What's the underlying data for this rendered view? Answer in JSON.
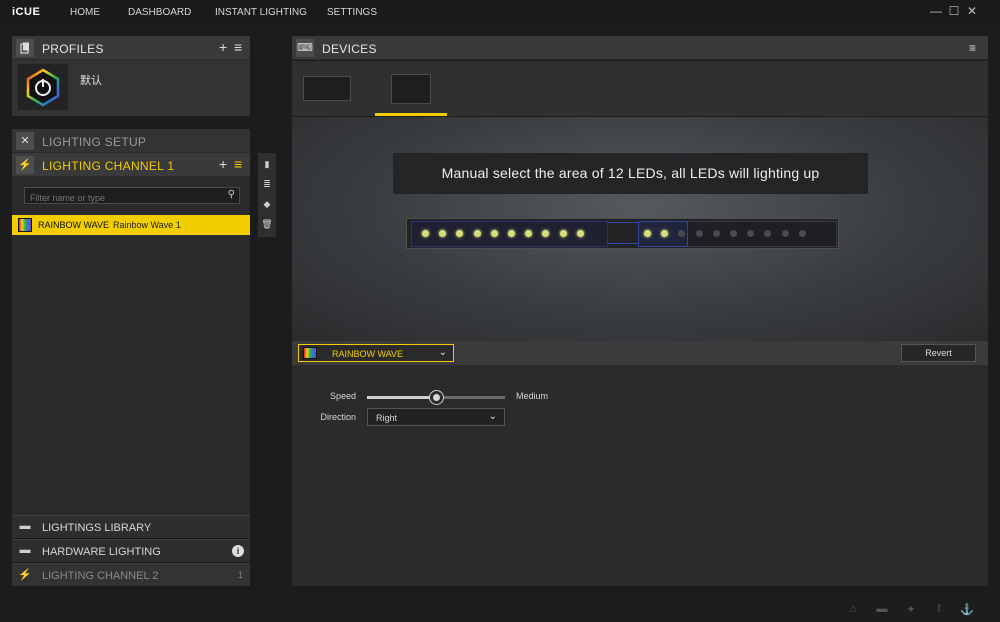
{
  "app": {
    "name": "iCUE"
  },
  "nav": [
    "HOME",
    "DASHBOARD",
    "INSTANT LIGHTING",
    "SETTINGS"
  ],
  "window_controls": {
    "minimize": "—",
    "maximize": "☐",
    "close": "✕"
  },
  "profiles": {
    "title": "PROFILES",
    "add": "+",
    "menu": "≡",
    "items": [
      {
        "name": "默认"
      }
    ]
  },
  "lighting_setup": {
    "title": "LIGHTING SETUP"
  },
  "lighting_channel": {
    "title": "LIGHTING CHANNEL 1",
    "add": "+",
    "menu": "≡",
    "filter_placeholder": "Filter name or type",
    "effects": [
      {
        "type": "RAINBOW WAVE",
        "name": "Rainbow Wave 1"
      }
    ]
  },
  "left_bottom": {
    "library": "LIGHTINGS LIBRARY",
    "hardware": "HARDWARE LIGHTING",
    "channel2": "LIGHTING CHANNEL 2",
    "channel2_count": "1"
  },
  "devices": {
    "title": "DEVICES"
  },
  "stage": {
    "banner": "Manual select the area of 12 LEDs, all LEDs will lighting up",
    "strip_left_leds": [
      1,
      1,
      1,
      1,
      1,
      1,
      1,
      1,
      1,
      1
    ],
    "strip_right_leds": [
      1,
      1,
      0,
      0,
      0,
      0,
      0,
      0,
      0,
      0
    ]
  },
  "effect_bar": {
    "selected_effect": "RAINBOW WAVE",
    "revert": "Revert"
  },
  "properties": {
    "speed_label": "Speed",
    "speed_value": "Medium",
    "speed_level": 0.5,
    "direction_label": "Direction",
    "direction_value": "Right"
  },
  "colors": {
    "accent": "#f2cd00",
    "selection": "#3240a0",
    "led_on": "#d8df7a"
  }
}
